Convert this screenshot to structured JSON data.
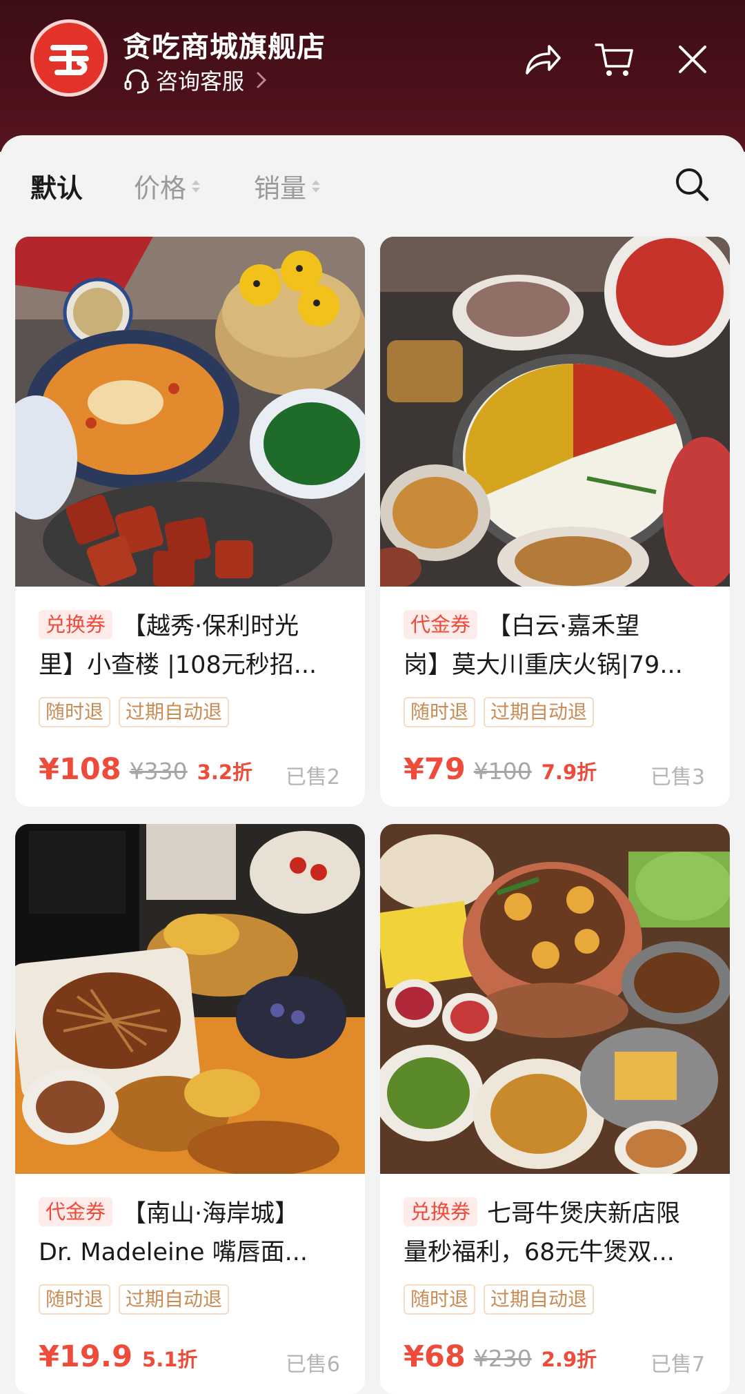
{
  "header": {
    "store_name": "贪吃商城旗舰店",
    "customer_service": "咨询客服",
    "logo_icon": "store-logo-icon",
    "share_icon": "share-icon",
    "cart_icon": "cart-icon",
    "close_icon": "close-icon"
  },
  "sort_bar": {
    "default_label": "默认",
    "price_label": "价格",
    "sales_label": "销量",
    "search_icon": "search-icon"
  },
  "colors": {
    "header_bg": "#4a1019",
    "accent_red": "#ee4b3b",
    "badge_bg": "#fdecea",
    "tag_border": "#f4dcc4",
    "tag_text": "#c98c55"
  },
  "products": [
    {
      "badge": "兑换券",
      "title_line1": "【越秀·保利时光",
      "title_line2": "里】小查楼 |108元秒招...",
      "tags": [
        "随时退",
        "过期自动退"
      ],
      "price": "¥108",
      "original_price": "¥330",
      "discount": "3.2折",
      "sold": "已售2"
    },
    {
      "badge": "代金券",
      "title_line1": "【白云·嘉禾望",
      "title_line2": "岗】莫大川重庆火锅|79...",
      "tags": [
        "随时退",
        "过期自动退"
      ],
      "price": "¥79",
      "original_price": "¥100",
      "discount": "7.9折",
      "sold": "已售3"
    },
    {
      "badge": "代金券",
      "title_line1": "【南山·海岸城】",
      "title_line2": "Dr. Madeleine 嘴唇面...",
      "tags": [
        "随时退",
        "过期自动退"
      ],
      "price": "¥19.9",
      "original_price": "",
      "discount": "5.1折",
      "sold": "已售6"
    },
    {
      "badge": "兑换券",
      "title_line1": "七哥牛煲庆新店限",
      "title_line2": "量秒福利，68元牛煲双...",
      "tags": [
        "随时退",
        "过期自动退"
      ],
      "price": "¥68",
      "original_price": "¥230",
      "discount": "2.9折",
      "sold": "已售7"
    }
  ]
}
